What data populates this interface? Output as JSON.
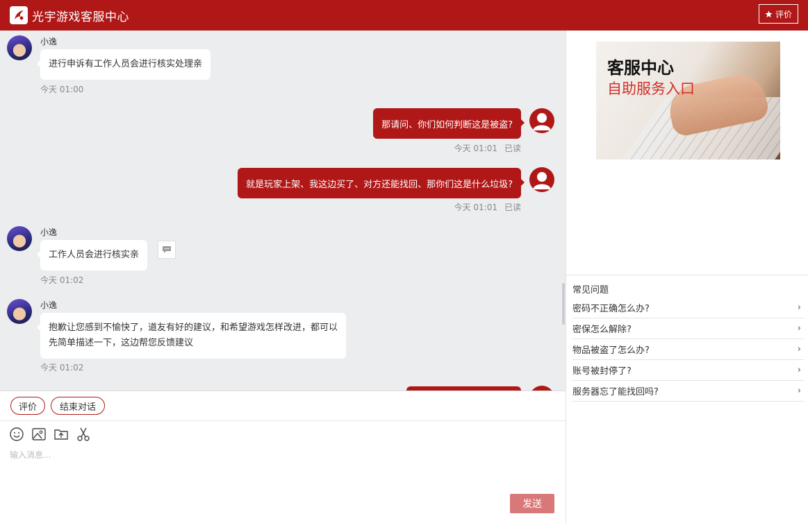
{
  "header": {
    "title": "光宇游戏客服中心",
    "rate_label": "评价"
  },
  "messages": [
    {
      "side": "agent",
      "name": "小逸",
      "text": "进行申诉有工作人员会进行核实处理亲",
      "time": "今天 01:00"
    },
    {
      "side": "user",
      "text": "那请问、你们如何判断这是被盗?",
      "time": "今天 01:01",
      "status": "已读"
    },
    {
      "side": "user",
      "text": "就是玩家上架、我这边买了、对方还能找回、那你们这是什么垃圾?",
      "time": "今天 01:01",
      "status": "已读"
    },
    {
      "side": "agent",
      "name": "小逸",
      "text": "工作人员会进行核实亲",
      "time": "今天 01:02"
    },
    {
      "side": "agent",
      "name": "小逸",
      "text_line1": "抱歉让您感到不愉快了，道友有好的建议，和希望游戏怎样改进，都可以",
      "text_line2": "先简单描述一下，这边帮您反馈建议",
      "time": "今天 01:02"
    }
  ],
  "actions": {
    "rate": "评价",
    "end": "结束对话"
  },
  "composer": {
    "placeholder": "输入消息...",
    "send": "发送"
  },
  "tools": [
    "emoji-icon",
    "image-icon",
    "upload-folder-icon",
    "scissors-icon"
  ],
  "sidebar": {
    "banner_title": "客服中心",
    "banner_subtitle": "自助服务入口",
    "faq_title": "常见问题",
    "faq": [
      "密码不正确怎么办?",
      "密保怎么解除?",
      "物品被盗了怎么办?",
      "账号被封停了?",
      "服务器忘了能找回吗?"
    ]
  },
  "colors": {
    "brand": "#b01818",
    "send_disabled": "#d97878",
    "chat_bg": "#ecedef"
  }
}
